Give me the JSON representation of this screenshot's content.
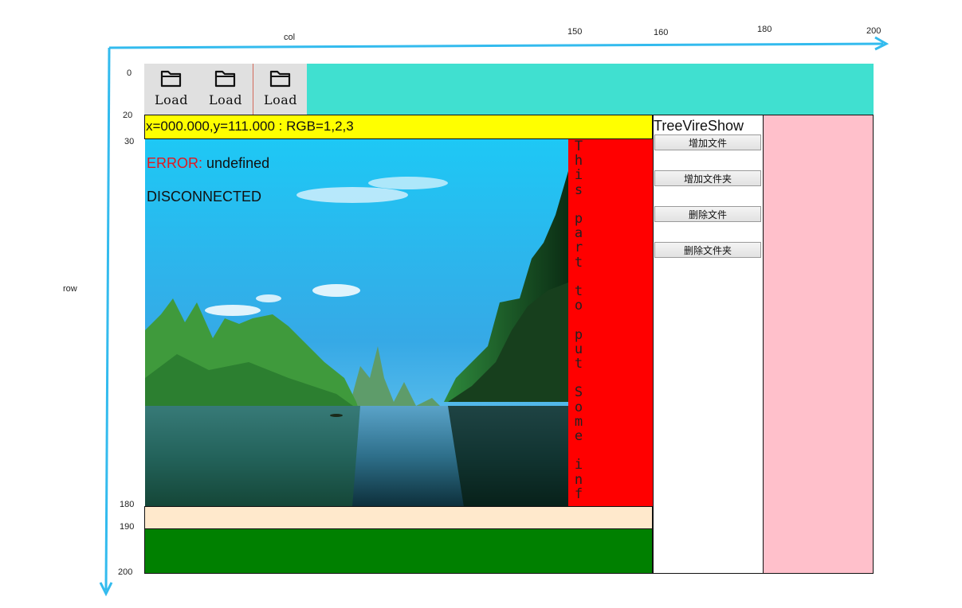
{
  "axes": {
    "col_label": "col",
    "row_label": "row",
    "col_ticks": [
      "150",
      "160",
      "180",
      "200"
    ],
    "row_ticks": [
      "0",
      "20",
      "30",
      "180",
      "190",
      "200"
    ],
    "arrow_color": "#33bbee"
  },
  "toolbar": {
    "buttons": [
      {
        "label": "Load",
        "icon": "folder-icon"
      },
      {
        "label": "Load",
        "icon": "folder-icon"
      },
      {
        "label": "Load",
        "icon": "folder-icon"
      }
    ],
    "bg_color": "#e0e0e0",
    "fill_color": "#40e0d0"
  },
  "status": {
    "coords": "x=000.000,y=111.000 : RGB=1,2,3",
    "bg_color": "#ffff00"
  },
  "viewer": {
    "error_label": "ERROR:",
    "error_value": "undefined",
    "connection": "DISCONNECTED",
    "error_color": "#e0191f"
  },
  "info_panel": {
    "text": "This part to put Some inf",
    "bg_color": "#ff0000"
  },
  "tree": {
    "title": "TreeVireShow",
    "buttons": [
      "增加文件",
      "增加文件夹",
      "删除文件",
      "删除文件夹"
    ]
  },
  "colors": {
    "beige_bar": "#ffe9cc",
    "green_bar": "#008000",
    "pink_panel": "#ffc0cb"
  }
}
